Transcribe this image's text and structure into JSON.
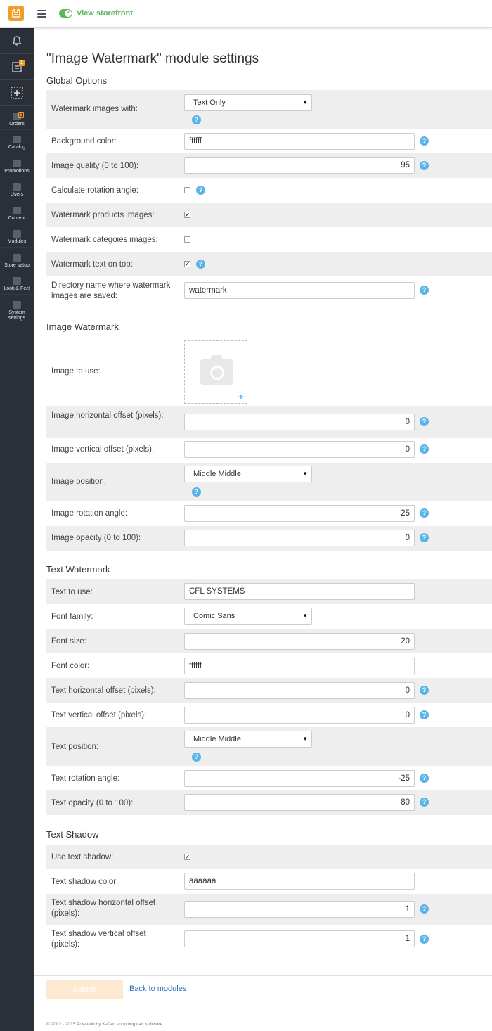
{
  "topbar": {
    "view_storefront": "View storefront"
  },
  "sidebar": {
    "top_badges": {
      "tasks": "1"
    },
    "items": [
      {
        "label": "Orders",
        "badge": "9",
        "icon": "orders-icon"
      },
      {
        "label": "Catalog",
        "icon": "catalog-icon"
      },
      {
        "label": "Promotions",
        "icon": "promotions-icon"
      },
      {
        "label": "Users",
        "icon": "users-icon"
      },
      {
        "label": "Content",
        "icon": "content-icon"
      },
      {
        "label": "Modules",
        "icon": "modules-icon"
      },
      {
        "label": "Store setup",
        "icon": "store-setup-icon"
      },
      {
        "label": "Look & Feel",
        "icon": "look-feel-icon"
      },
      {
        "label": "System settings",
        "icon": "system-settings-icon"
      }
    ]
  },
  "page": {
    "title": "\"Image Watermark\" module settings"
  },
  "global": {
    "title": "Global Options",
    "watermark_with": {
      "label": "Watermark images with:",
      "value": "Text Only"
    },
    "bg_color": {
      "label": "Background color:",
      "value": "ffffff"
    },
    "quality": {
      "label": "Image quality (0 to 100):",
      "value": "95"
    },
    "rotation": {
      "label": "Calculate rotation angle:",
      "checked": false
    },
    "products": {
      "label": "Watermark products images:",
      "checked": true
    },
    "categories": {
      "label": "Watermark categoies images:",
      "checked": false
    },
    "text_top": {
      "label": "Watermark text on top:",
      "checked": true
    },
    "dir": {
      "label": "Directory name where watermark images are saved:",
      "value": "watermark"
    }
  },
  "image": {
    "title": "Image Watermark",
    "image_to_use": {
      "label": "Image to use:"
    },
    "h_offset": {
      "label": "Image horizontal offset (pixels):",
      "value": "0"
    },
    "v_offset": {
      "label": "Image vertical offset (pixels):",
      "value": "0"
    },
    "position": {
      "label": "Image position:",
      "value": "Middle Middle"
    },
    "rotation": {
      "label": "Image rotation angle:",
      "value": "25"
    },
    "opacity": {
      "label": "Image opacity (0 to 100):",
      "value": "0"
    }
  },
  "text": {
    "title": "Text Watermark",
    "text_to_use": {
      "label": "Text to use:",
      "value": "CFL SYSTEMS"
    },
    "font_family": {
      "label": "Font family:",
      "value": "Comic Sans"
    },
    "font_size": {
      "label": "Font size:",
      "value": "20"
    },
    "font_color": {
      "label": "Font color:",
      "value": "ffffff"
    },
    "h_offset": {
      "label": "Text horizontal offset (pixels):",
      "value": "0"
    },
    "v_offset": {
      "label": "Text vertical offset (pixels):",
      "value": "0"
    },
    "position": {
      "label": "Text position:",
      "value": "Middle Middle"
    },
    "rotation": {
      "label": "Text rotation angle:",
      "value": "-25"
    },
    "opacity": {
      "label": "Text opacity (0 to 100):",
      "value": "80"
    }
  },
  "shadow": {
    "title": "Text Shadow",
    "use": {
      "label": "Use text shadow:",
      "checked": true
    },
    "color": {
      "label": "Text shadow color:",
      "value": "aaaaaa"
    },
    "h_offset": {
      "label": "Text shadow horizontal offset (pixels):",
      "value": "1"
    },
    "v_offset": {
      "label": "Text shadow vertical offset (pixels):",
      "value": "1"
    }
  },
  "actions": {
    "submit": "Submit",
    "back": "Back to modules"
  },
  "footer": {
    "copyright": "© 2002 - 2015 Powered by X-Cart shopping cart software"
  },
  "help_glyph": "?",
  "checkmark_glyph": "✔",
  "caret_glyph": "▼",
  "plus_glyph": "+",
  "colors": {
    "accent": "#f39c2a",
    "green": "#5cb85c",
    "help": "#5bb4e8",
    "sidebar": "#2b2f38"
  }
}
